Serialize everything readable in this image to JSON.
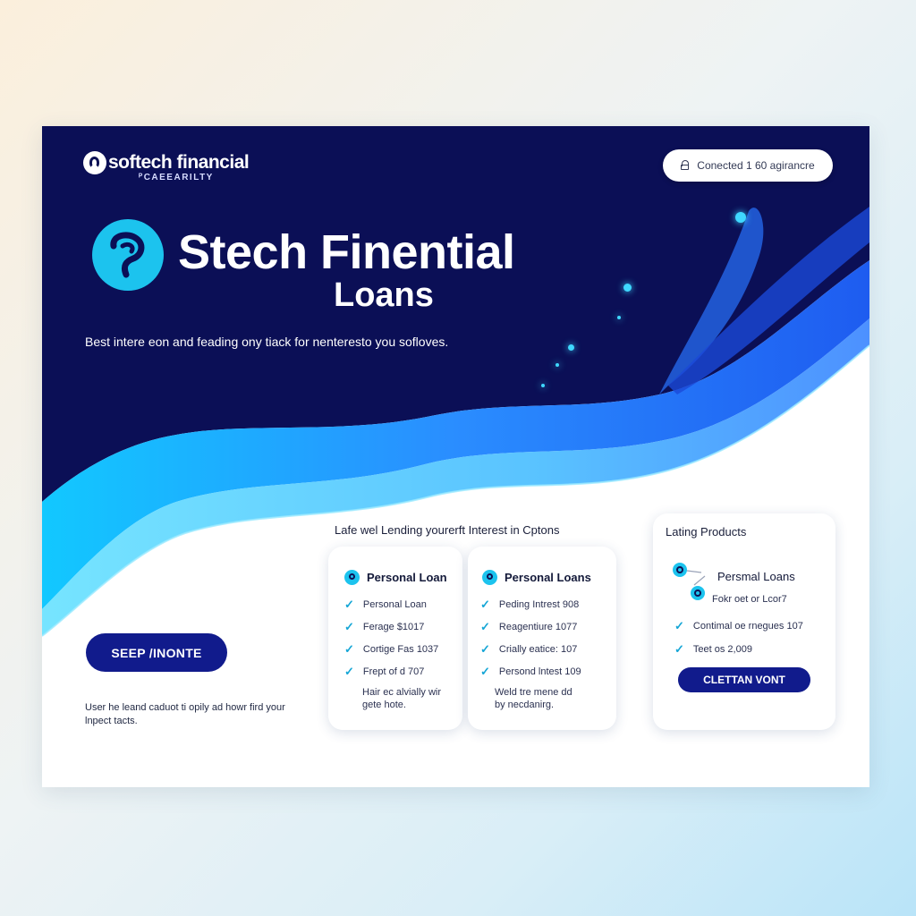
{
  "brand": {
    "name": "softech financial",
    "tagline": "ᴾCAEEARILTY"
  },
  "header": {
    "status_label": "Conected 1 60 agirancre"
  },
  "hero": {
    "title": "Stech Finential",
    "subtitle": "Loans",
    "description": "Best intere eon and feading ony tiack for nenteresto you sofloves."
  },
  "cta": {
    "label": "SEEP /INONTE"
  },
  "footer_note": "User he leand caduot ti opily ad howr fird your lnpect tacts.",
  "section": {
    "heading": "Lafe wel Lending yourerft Interest in Cptons"
  },
  "cards": [
    {
      "title": "Personal Loan",
      "icon": "pin-icon",
      "features": [
        "Personal Loan",
        "Ferage $1017",
        "Cortige Fas 1037",
        "Frept of d 707"
      ],
      "note": "Hair ec alvially wir gete hote."
    },
    {
      "title": "Personal Loans",
      "icon": "pin-icon",
      "features": [
        "Peding Intrest 908",
        "Reagentiure 1077",
        "Crially eatice: 107",
        "Persond lntest 109"
      ],
      "note": "Weld tre mene dd by necdanirg."
    },
    {
      "section_title": "Lating Products",
      "title": "Persmal Loans",
      "subtitle": "Fokr oet or Lcor7",
      "icon": "node-icon",
      "features": [
        "Contimal oe rnegues 107",
        "Teet os 2,009"
      ],
      "button_label": "CLETTAN VONT"
    }
  ],
  "colors": {
    "navy": "#0a0f4f",
    "accent_blue": "#1cc3ee",
    "button_blue": "#111b8c",
    "wave_blue": "#2fa8ff"
  }
}
